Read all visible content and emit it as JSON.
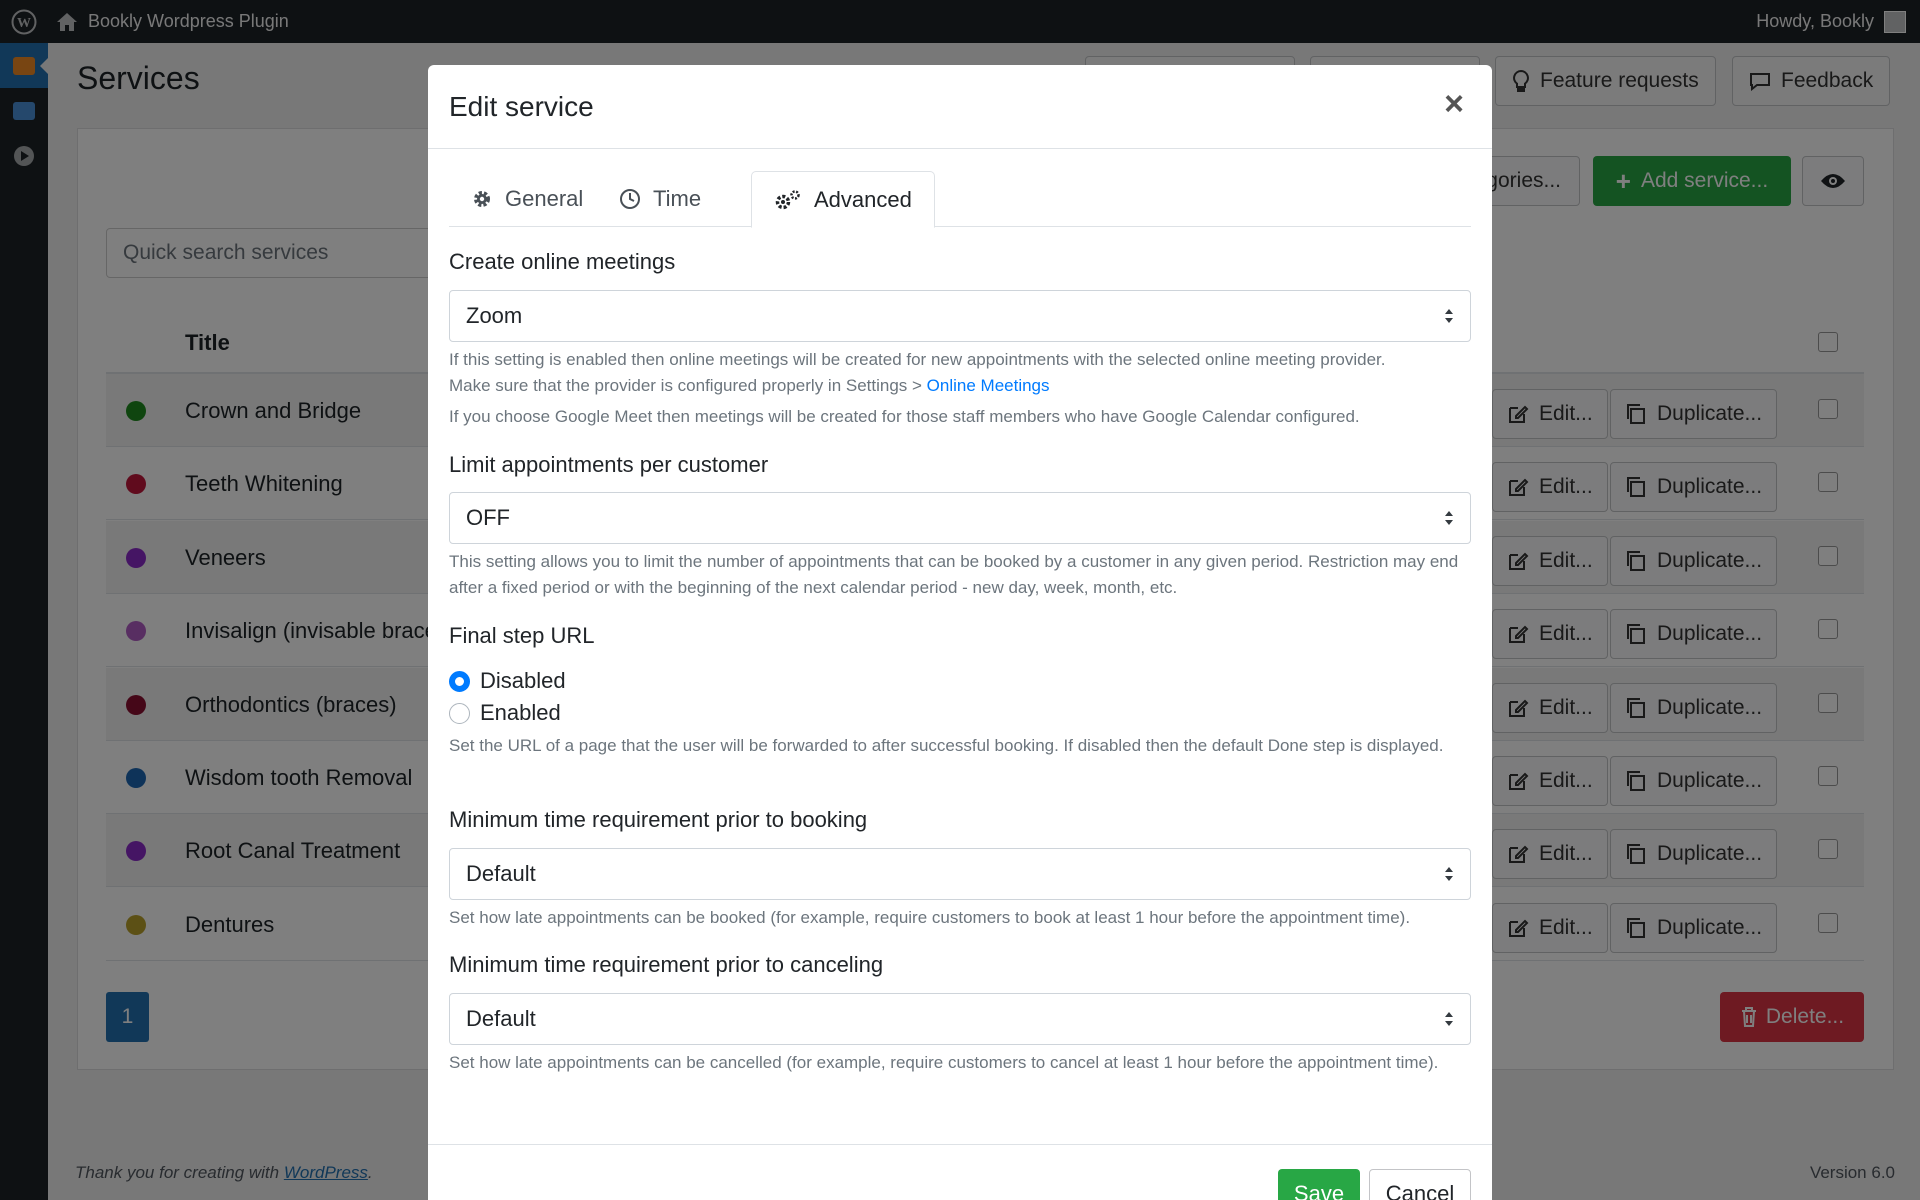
{
  "adminbar": {
    "site_name": "Bookly Wordpress Plugin",
    "howdy": "Howdy, Bookly"
  },
  "page": {
    "title": "Services",
    "header_buttons": {
      "feature_requests": "Feature requests",
      "feedback": "Feedback"
    },
    "categories_button": "gories...",
    "add_service_button": "Add service...",
    "search_placeholder": "Quick search services",
    "table": {
      "title_header": "Title",
      "rows": [
        {
          "name": "Crown and Bridge",
          "color": "#1e8a1e",
          "edit": "Edit...",
          "duplicate": "Duplicate..."
        },
        {
          "name": "Teeth Whitening",
          "color": "#c0163b",
          "edit": "Edit...",
          "duplicate": "Duplicate..."
        },
        {
          "name": "Veneers",
          "color": "#8a2bc9",
          "edit": "Edit...",
          "duplicate": "Duplicate..."
        },
        {
          "name": "Invisalign (invisable brace",
          "color": "#b05cc4",
          "edit": "Edit...",
          "duplicate": "Duplicate..."
        },
        {
          "name": "Orthodontics (braces)",
          "color": "#8b0f30",
          "edit": "Edit...",
          "duplicate": "Duplicate..."
        },
        {
          "name": "Wisdom tooth Removal",
          "color": "#1c66b2",
          "edit": "Edit...",
          "duplicate": "Duplicate..."
        },
        {
          "name": "Root Canal Treatment",
          "color": "#8a2bc9",
          "edit": "Edit...",
          "duplicate": "Duplicate..."
        },
        {
          "name": "Dentures",
          "color": "#b8a02a",
          "edit": "Edit...",
          "duplicate": "Duplicate..."
        }
      ]
    },
    "pager_current": "1",
    "delete_button": "Delete...",
    "footer_text": "Thank you for creating with ",
    "footer_link": "WordPress",
    "footer_dot": ".",
    "version": "Version 6.0"
  },
  "modal": {
    "title": "Edit service",
    "close": "×",
    "tabs": [
      {
        "label": "General",
        "icon": "gear-icon"
      },
      {
        "label": "Time",
        "icon": "clock-icon"
      },
      {
        "label": "Advanced",
        "icon": "gears-icon",
        "active": true
      }
    ],
    "online_meetings": {
      "label": "Create online meetings",
      "value": "Zoom",
      "help1": "If this setting is enabled then online meetings will be created for new appointments with the selected online meeting provider.",
      "help2_prefix": "Make sure that the provider is configured properly in Settings > ",
      "help2_link": "Online Meetings",
      "help3": "If you choose Google Meet then meetings will be created for those staff members who have Google Calendar configured."
    },
    "limit_appointments": {
      "label": "Limit appointments per customer",
      "value": "OFF",
      "help": "This setting allows you to limit the number of appointments that can be booked by a customer in any given period. Restriction may end after a fixed period or with the beginning of the next calendar period - new day, week, month, etc."
    },
    "final_step_url": {
      "label": "Final step URL",
      "option_disabled": "Disabled",
      "option_enabled": "Enabled",
      "selected": "Disabled",
      "help": "Set the URL of a page that the user will be forwarded to after successful booking. If disabled then the default Done step is displayed."
    },
    "min_time_booking": {
      "label": "Minimum time requirement prior to booking",
      "value": "Default",
      "help": "Set how late appointments can be booked (for example, require customers to book at least 1 hour before the appointment time)."
    },
    "min_time_canceling": {
      "label": "Minimum time requirement prior to canceling",
      "value": "Default",
      "help": "Set how late appointments can be cancelled (for example, require customers to cancel at least 1 hour before the appointment time)."
    },
    "save": "Save",
    "cancel": "Cancel"
  },
  "colors": {
    "primary": "#007bff",
    "success": "#28a745",
    "danger": "#dc3545",
    "wp_blue": "#2271b1"
  }
}
